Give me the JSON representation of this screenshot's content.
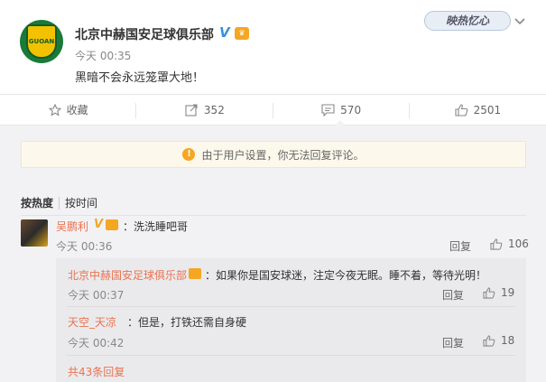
{
  "post": {
    "author": "北京中赫国安足球俱乐部",
    "time": "今天 00:35",
    "content": "黑暗不会永远笼罩大地！",
    "avatar_text": "GUOAN",
    "watermark": "映热忆心"
  },
  "actions": {
    "favorite_label": "收藏",
    "repost_count": "352",
    "comment_count": "570",
    "like_count": "2501"
  },
  "notice": "由于用户设置，你无法回复评论。",
  "sort": {
    "by_hot": "按热度",
    "by_time": "按时间"
  },
  "comment": {
    "user": "吴鹏利",
    "text": "：洗洗睡吧哥",
    "time": "今天 00:36",
    "reply_label": "回复",
    "likes": "106"
  },
  "replies": [
    {
      "user": "北京中赫国安足球俱乐部",
      "text": "：如果你是国安球迷，注定今夜无眠。睡不着，等待光明！",
      "time": "今天 00:37",
      "reply_label": "回复",
      "likes": "19"
    },
    {
      "user": "天空_天凉",
      "text": "：但是，打铁还需自身硬",
      "time": "今天 00:42",
      "reply_label": "回复",
      "likes": "18"
    }
  ],
  "total_replies": "共43条回复",
  "colors": {
    "link_orange": "#eb7350",
    "notice_bg": "#fdf8ec",
    "verified_blue": "#3a8fe0"
  }
}
